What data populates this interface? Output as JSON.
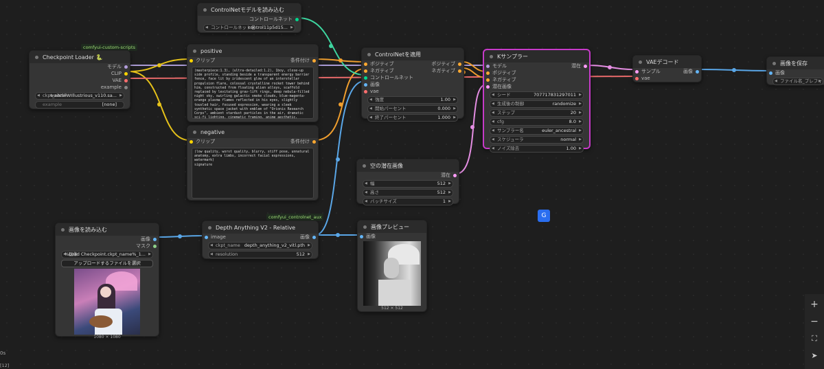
{
  "groups": {
    "custom_scripts": "comfyui-custom-scripts",
    "controlnet_aux": "comfyui_controlnet_aux"
  },
  "checkpoint": {
    "title": "Checkpoint Loader",
    "badge": "🐍",
    "outputs": [
      "モデル",
      "CLIP",
      "VAE",
      "example"
    ],
    "ckpt_label": "ckpt_name",
    "ckpt_value": "waiNSFWIllustrious_v110.sa...",
    "example_placeholder": "example",
    "example_value": "[none]"
  },
  "cn_loader": {
    "title": "ControlNetモデルを読み込む",
    "output": "コントロールネット",
    "name_label": "コントロールネット名",
    "name_value": "control11p5d15..."
  },
  "positive": {
    "title": "positive",
    "input": "クリップ",
    "output": "条件付け",
    "text": "(masterpiece:1.3), (ultra-detailed:1.2), 1boy, close-up side profile, standing beside a transparent energy barrier fence, face lit by iridescent glow of an interstellar propulsion flare, colossal crystalline rocket tower behind him, constructed from floating alien alloys, scaffold replaced by levitating grav-lift rings, deep nebula-filled night sky, swirling galactic smoke clouds, blue-magenta-orange plasma flames reflected in his eyes, slightly tousled hair, focused expression, wearing a sleek synthetic space jacket with emblem of \"Orionis Research Corps\", ambient stardust particles in the air, dramatic sci-fi lighting, cinematic framing, anime aesthetic, motion blur from ion vapor and energy fog, electric anticipation in the void"
  },
  "negative": {
    "title": "negative",
    "input": "クリップ",
    "output": "条件付け",
    "text": "(low quality, worst quality, blurry, stiff pose, unnatural anatomy, extra limbs, incorrect facial expressions, watermark)\nsignature"
  },
  "cn_apply": {
    "title": "ControlNetを適用",
    "inputs": [
      "ポジティブ",
      "ネガティブ",
      "コントロールネット",
      "画像",
      "vae"
    ],
    "outputs": [
      "ポジティブ",
      "ネガティブ"
    ],
    "widgets": [
      {
        "label": "強度",
        "value": "1.00"
      },
      {
        "label": "開始パーセント",
        "value": "0.000"
      },
      {
        "label": "終了パーセント",
        "value": "1.000"
      }
    ]
  },
  "ksampler": {
    "title": "Kサンプラー",
    "inputs": [
      "モデル",
      "ポジティブ",
      "ネガティブ",
      "潜在画像"
    ],
    "output": "潜在",
    "widgets": [
      {
        "label": "シード",
        "value": "707717831297011"
      },
      {
        "label": "生成後の制御",
        "value": "randomize"
      },
      {
        "label": "ステップ",
        "value": "20"
      },
      {
        "label": "cfg",
        "value": "8.0"
      },
      {
        "label": "サンプラー名",
        "value": "euler_ancestral"
      },
      {
        "label": "スケジューラ",
        "value": "normal"
      },
      {
        "label": "ノイズ除去",
        "value": "1.00"
      }
    ]
  },
  "vae_decode": {
    "title": "VAEデコード",
    "inputs": [
      "サンプル",
      "vae"
    ],
    "output": "画像"
  },
  "save": {
    "title": "画像を保存",
    "input": "画像",
    "prefix_label": "ファイル名_プレフィックス"
  },
  "empty_latent": {
    "title": "空の潜在画像",
    "output": "潜在",
    "widgets": [
      {
        "label": "幅",
        "value": "512"
      },
      {
        "label": "高さ",
        "value": "512"
      },
      {
        "label": "バッチサイズ",
        "value": "1"
      }
    ]
  },
  "load_image": {
    "title": "画像を読み込む",
    "outputs": [
      "画像",
      "マスク"
    ],
    "image_label": "画像",
    "image_value": "%Load Checkpoint.ckpt_name%_1...",
    "upload_label": "アップロードするファイルを選択",
    "caption": "1080 × 1080"
  },
  "depth": {
    "title": "Depth Anything V2 - Relative",
    "input": "image",
    "output": "画像",
    "widgets": [
      {
        "label": "ckpt_name",
        "value": "depth_anything_v2_vitl.pth"
      },
      {
        "label": "resolution",
        "value": "512"
      }
    ]
  },
  "preview": {
    "title": "画像プレビュー",
    "input": "画像",
    "caption": "512 × 512"
  },
  "sidebar": {
    "time": "0s",
    "queue": "[12]"
  },
  "zoom": {
    "plus": "+",
    "minus": "−",
    "fit": "⛶",
    "arrow": "➤"
  },
  "colors": {
    "model": "#b39ddb",
    "clip": "#ffd500",
    "vae": "#ff6e6e",
    "cond": "#ffa931",
    "latent": "#ff9cf9",
    "image": "#64b5f6",
    "control": "#00d78d"
  }
}
